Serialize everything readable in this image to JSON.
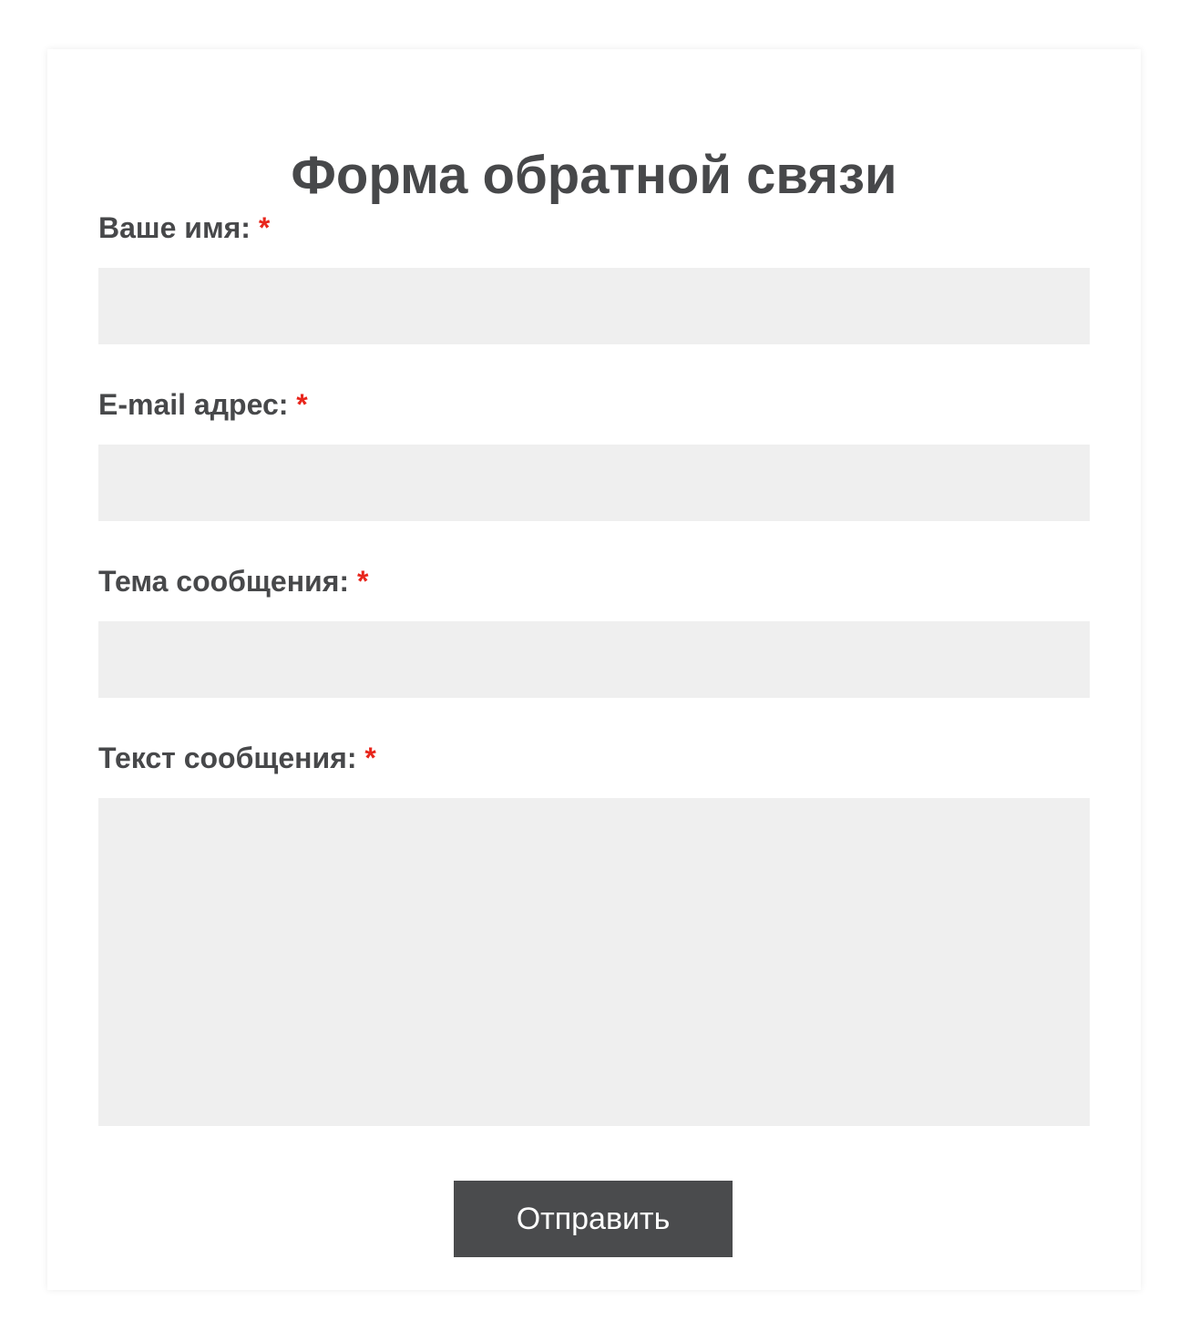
{
  "form": {
    "title": "Форма обратной связи",
    "required_mark": "*",
    "fields": [
      {
        "label": "Ваше имя:",
        "value": ""
      },
      {
        "label": "E-mail адрес:",
        "value": ""
      },
      {
        "label": "Тема сообщения:",
        "value": ""
      },
      {
        "label": "Текст сообщения:",
        "value": ""
      }
    ],
    "submit_label": "Отправить"
  },
  "colors": {
    "text": "#47484a",
    "required": "#e8261c",
    "field_bg": "#efefef",
    "button_bg": "#4a4b4d"
  }
}
